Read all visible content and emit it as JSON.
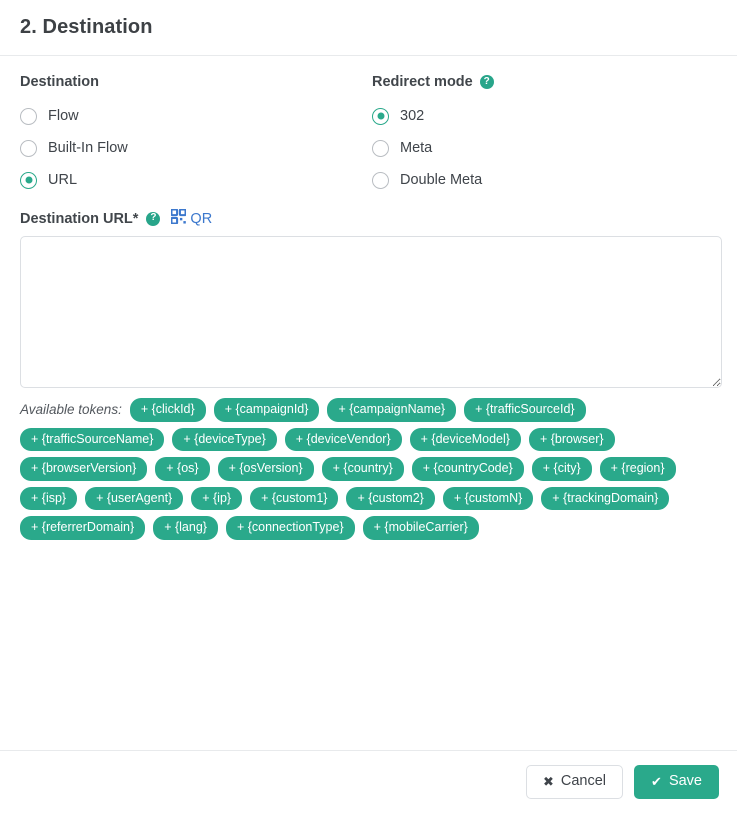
{
  "header": {
    "title": "2. Destination"
  },
  "destination_group": {
    "label": "Destination",
    "options": [
      {
        "label": "Flow",
        "checked": false
      },
      {
        "label": "Built-In Flow",
        "checked": false
      },
      {
        "label": "URL",
        "checked": true
      }
    ]
  },
  "redirect_group": {
    "label": "Redirect mode",
    "help_icon": "question-mark-icon",
    "help_glyph": "?",
    "options": [
      {
        "label": "302",
        "checked": true
      },
      {
        "label": "Meta",
        "checked": false
      },
      {
        "label": "Double Meta",
        "checked": false
      }
    ]
  },
  "url_field": {
    "label": "Destination URL*",
    "help_icon": "question-mark-icon",
    "help_glyph": "?",
    "qr_icon": "qr-code-icon",
    "qr_label": "QR",
    "value": "",
    "placeholder": ""
  },
  "tokens": {
    "label": "Available tokens:",
    "items": [
      "+ {clickId}",
      "+ {campaignId}",
      "+ {campaignName}",
      "+ {trafficSourceId}",
      "+ {trafficSourceName}",
      "+ {deviceType}",
      "+ {deviceVendor}",
      "+ {deviceModel}",
      "+ {browser}",
      "+ {browserVersion}",
      "+ {os}",
      "+ {osVersion}",
      "+ {country}",
      "+ {countryCode}",
      "+ {city}",
      "+ {region}",
      "+ {isp}",
      "+ {userAgent}",
      "+ {ip}",
      "+ {custom1}",
      "+ {custom2}",
      "+ {customN}",
      "+ {trackingDomain}",
      "+ {referrerDomain}",
      "+ {lang}",
      "+ {connectionType}",
      "+ {mobileCarrier}"
    ]
  },
  "footer": {
    "cancel_label": "Cancel",
    "cancel_glyph": "✖",
    "save_label": "Save",
    "save_glyph": "✔"
  },
  "colors": {
    "accent_green": "#2aa98b",
    "link_blue": "#3c78cd",
    "border_gray": "#dcdfe3",
    "text_dark": "#3f444a"
  }
}
